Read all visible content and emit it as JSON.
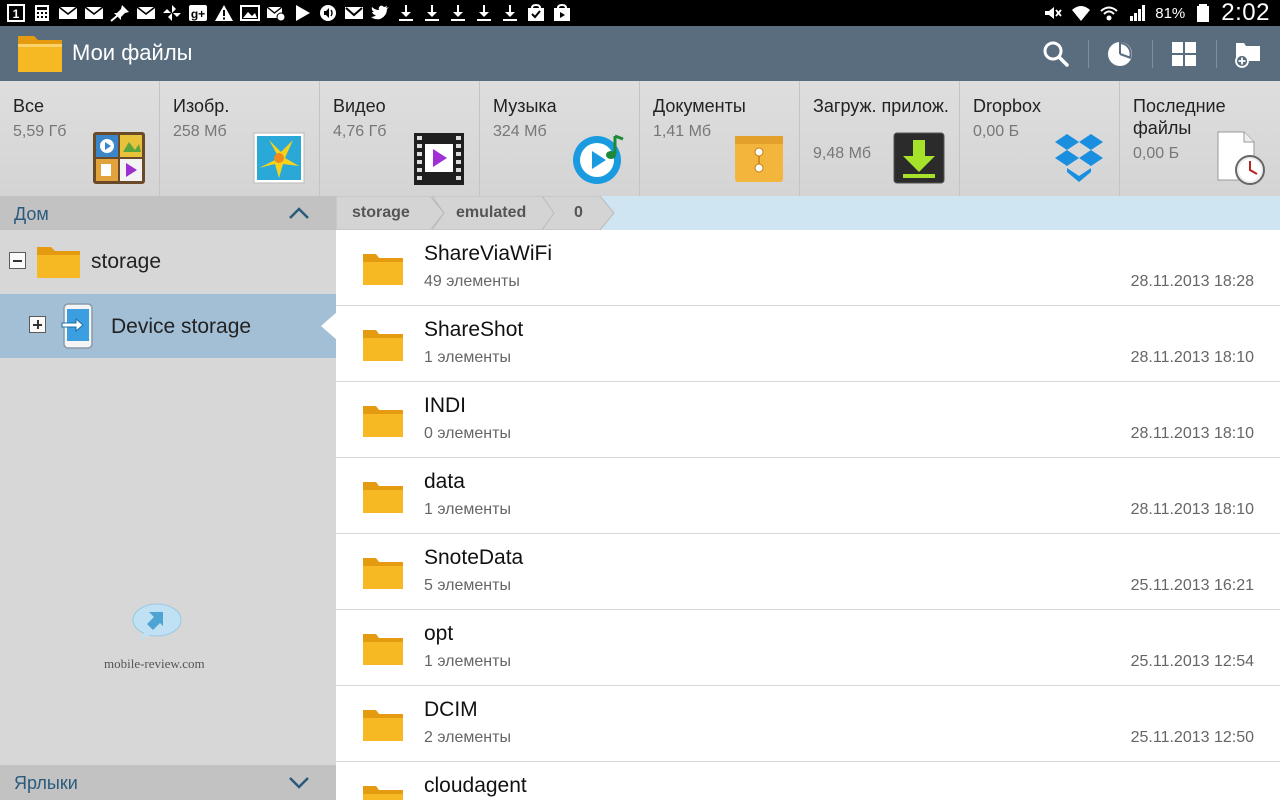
{
  "status_bar": {
    "notification_icons": [
      "sim-1-icon",
      "calculator-icon",
      "email-icon",
      "email-icon",
      "pin-icon",
      "email-icon",
      "google-photos-icon",
      "google-plus-icon",
      "warning-icon",
      "gallery-icon",
      "email-settings-icon",
      "play-icon",
      "voice-icon",
      "gmail-icon",
      "twitter-icon",
      "download-icon",
      "download-icon",
      "download-icon",
      "download-icon",
      "download-icon",
      "check-bag-icon",
      "play-store-icon"
    ],
    "battery_percent": "81%",
    "time": "2:02"
  },
  "action_bar": {
    "title": "Мои файлы",
    "actions": [
      "search-icon",
      "storage-usage-icon",
      "view-mode-icon",
      "new-folder-icon"
    ]
  },
  "categories": [
    {
      "label": "Все",
      "size": "5,59 Гб",
      "icon": "all-files-icon"
    },
    {
      "label": "Изобр.",
      "size": "258 Мб",
      "icon": "images-icon"
    },
    {
      "label": "Видео",
      "size": "4,76 Гб",
      "icon": "video-icon"
    },
    {
      "label": "Музыка",
      "size": "324 Мб",
      "icon": "music-icon"
    },
    {
      "label": "Документы",
      "size": "1,41 Мб",
      "icon": "documents-icon"
    },
    {
      "label": "Загруж. прилож.",
      "size": "9,48 Мб",
      "icon": "downloaded-apps-icon"
    },
    {
      "label": "Dropbox",
      "size": "0,00 Б",
      "icon": "dropbox-icon"
    },
    {
      "label": "Последние файлы",
      "size": "0,00 Б",
      "icon": "recent-files-icon"
    }
  ],
  "left_panel": {
    "header": "Дом",
    "tree": [
      {
        "label": "storage",
        "expanded": true
      },
      {
        "label": "Device storage",
        "expanded": false,
        "selected": true
      }
    ],
    "watermark": "mobile-review.com",
    "footer": "Ярлыки"
  },
  "breadcrumb": [
    "storage",
    "emulated",
    "0"
  ],
  "files": [
    {
      "name": "ShareViaWiFi",
      "count": "49 элементы",
      "date": "28.11.2013 18:28"
    },
    {
      "name": "ShareShot",
      "count": "1 элементы",
      "date": "28.11.2013 18:10"
    },
    {
      "name": "INDI",
      "count": "0 элементы",
      "date": "28.11.2013 18:10"
    },
    {
      "name": "data",
      "count": "1 элементы",
      "date": "28.11.2013 18:10"
    },
    {
      "name": "SnoteData",
      "count": "5 элементы",
      "date": "25.11.2013 16:21"
    },
    {
      "name": "opt",
      "count": "1 элементы",
      "date": "25.11.2013 12:54"
    },
    {
      "name": "DCIM",
      "count": "2 элементы",
      "date": "25.11.2013 12:50"
    },
    {
      "name": "cloudagent",
      "count": "",
      "date": ""
    }
  ],
  "colors": {
    "action_bar": "#5a6d7f",
    "selection": "#a3bfd6",
    "breadcrumb_bg": "#cfe5f1",
    "folder": "#f4b21e"
  }
}
